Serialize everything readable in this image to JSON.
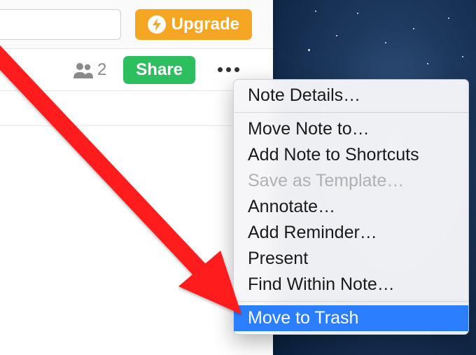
{
  "toolbar": {
    "upgrade_label": "Upgrade"
  },
  "actions": {
    "share_count": "2",
    "share_label": "Share"
  },
  "menu": {
    "note_details": "Note Details…",
    "move_note_to": "Move Note to…",
    "add_to_shortcuts": "Add Note to Shortcuts",
    "save_template": "Save as Template…",
    "annotate": "Annotate…",
    "add_reminder": "Add Reminder…",
    "present": "Present",
    "find_within": "Find Within Note…",
    "move_to_trash": "Move to Trash"
  }
}
